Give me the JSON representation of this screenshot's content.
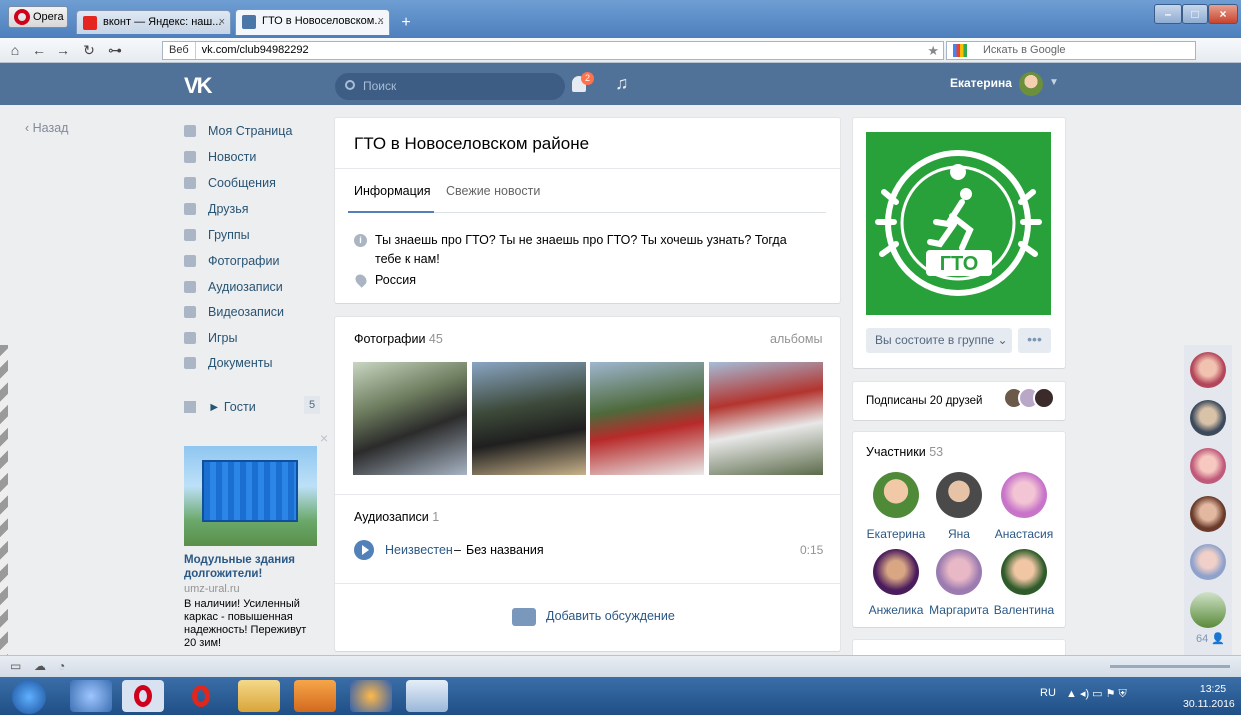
{
  "browser": {
    "menu_label": "Opera",
    "tabs": [
      {
        "label": "вконт — Яндекс: наш..."
      },
      {
        "label": "ГТО в Новоселовском..."
      }
    ],
    "new_tab": "+",
    "web_label": "Веб",
    "url": "vk.com/club94982292",
    "search_placeholder": "Искать в Google"
  },
  "vk_header": {
    "logo": "VK",
    "search_placeholder": "Поиск",
    "notification_count": "2",
    "user_name": "Екатерина"
  },
  "left_nav": {
    "back": "Назад",
    "items": [
      {
        "label": "Моя Страница",
        "icon": "home-icon"
      },
      {
        "label": "Новости",
        "icon": "news-icon"
      },
      {
        "label": "Сообщения",
        "icon": "messages-icon"
      },
      {
        "label": "Друзья",
        "icon": "friends-icon"
      },
      {
        "label": "Группы",
        "icon": "groups-icon"
      },
      {
        "label": "Фотографии",
        "icon": "camera-icon"
      },
      {
        "label": "Аудиозаписи",
        "icon": "music-icon"
      },
      {
        "label": "Видеозаписи",
        "icon": "video-icon"
      },
      {
        "label": "Игры",
        "icon": "gamepad-icon"
      },
      {
        "label": "Документы",
        "icon": "document-icon"
      }
    ],
    "guests": "► Гости",
    "guests_count": "5"
  },
  "ad": {
    "title": "Модульные здания долгожители!",
    "domain": "umz-ural.ru",
    "text": "В наличии! Усиленный каркас - повышенная надежность! Переживут 20 зим!"
  },
  "group": {
    "title": "ГТО в Новоселовском районе",
    "tab_info": "Информация",
    "tab_news": "Свежие новости",
    "status": "Ты знаешь про ГТО? Ты не знаешь про ГТО? Ты хочешь узнать? Тогда тебе к нам!",
    "country": "Россия",
    "photos_label": "Фотографии",
    "photos_count": "45",
    "albums_label": "альбомы",
    "audio_label": "Аудиозаписи",
    "audio_count": "1",
    "track_artist": "Неизвестен",
    "track_dash": "–",
    "track_title": "Без названия",
    "track_duration": "0:15",
    "add_discussion": "Добавить обсуждение"
  },
  "right": {
    "logo_text": "ГТО",
    "member_button": "Вы состоите в группе",
    "more_button": "•••",
    "friends_subscribed": "Подписаны 20 друзей",
    "members_label": "Участники",
    "members_count": "53",
    "members": [
      {
        "name": "Екатерина"
      },
      {
        "name": "Яна"
      },
      {
        "name": "Анастасия"
      },
      {
        "name": "Анжелика"
      },
      {
        "name": "Маргарита"
      },
      {
        "name": "Валентина"
      }
    ],
    "strip_count": "64"
  },
  "taskbar": {
    "lang": "RU",
    "time": "13:25",
    "date": "30.11.2016"
  },
  "colors": {
    "vk_blue": "#507299",
    "link": "#2a5885",
    "gto_green": "#29a13a"
  }
}
